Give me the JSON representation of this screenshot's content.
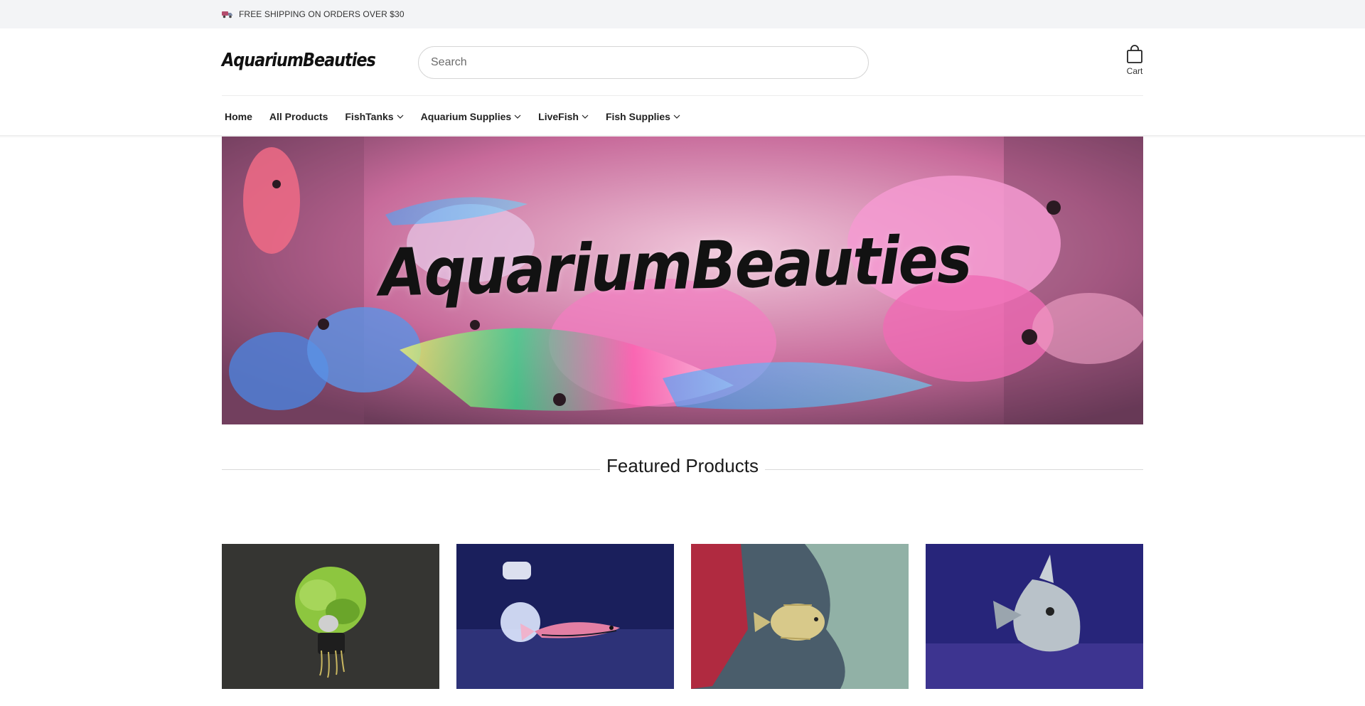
{
  "announcement": {
    "icon": "truck-icon",
    "text": "FREE SHIPPING ON ORDERS OVER $30"
  },
  "header": {
    "logo": "AquariumBeauties",
    "search": {
      "placeholder": "Search",
      "value": ""
    },
    "cart": {
      "icon": "shopping-bag-icon",
      "label": "Cart"
    }
  },
  "nav": {
    "items": [
      {
        "label": "Home",
        "dropdown": false
      },
      {
        "label": "All Products",
        "dropdown": false
      },
      {
        "label": "FishTanks",
        "dropdown": true
      },
      {
        "label": "Aquarium Supplies",
        "dropdown": true
      },
      {
        "label": "LiveFish",
        "dropdown": true
      },
      {
        "label": "Fish Supplies",
        "dropdown": true
      }
    ]
  },
  "hero": {
    "title": "AquariumBeauties"
  },
  "featured": {
    "heading": "Featured Products",
    "products": [
      {
        "image": "aquatic-plant-image"
      },
      {
        "image": "pink-wrasse-fish-image"
      },
      {
        "image": "rabbitfish-image"
      },
      {
        "image": "silver-moonfish-image"
      }
    ]
  },
  "colors": {
    "announcement_bg": "#f3f4f6",
    "text": "#1f1f1f",
    "border": "#d6d6d6"
  }
}
